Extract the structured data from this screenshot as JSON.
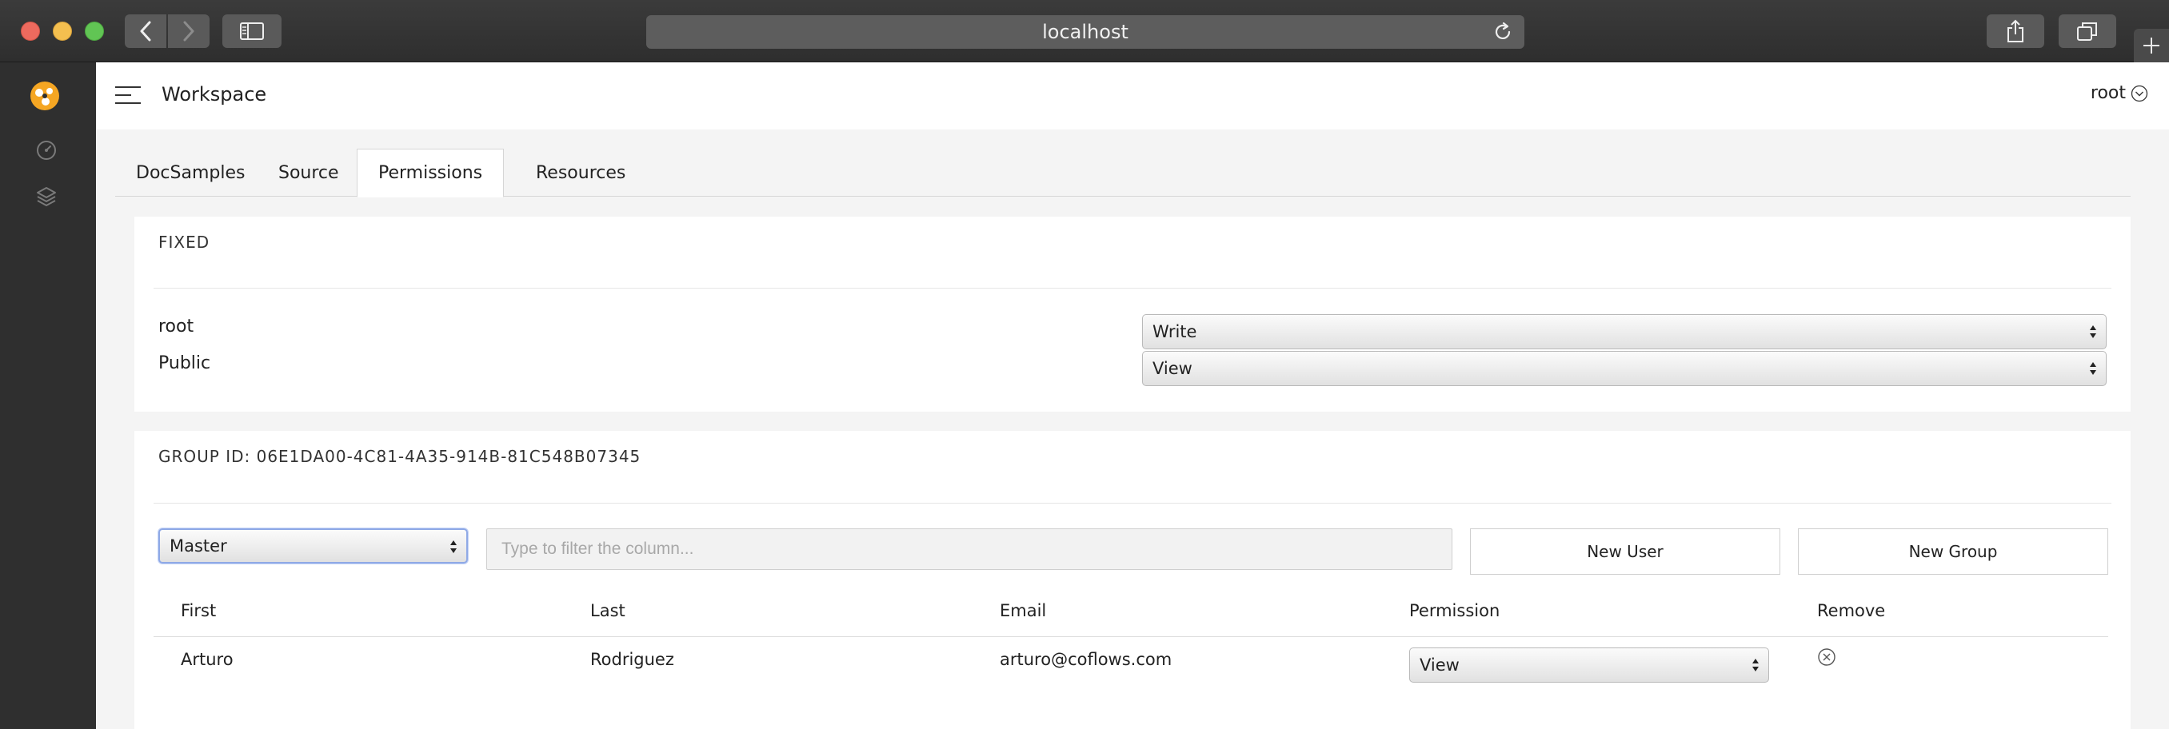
{
  "browser": {
    "url": "localhost"
  },
  "icons": {
    "logo": "app-logo-icon",
    "dashboard": "gauge-icon",
    "resources": "layers-icon",
    "user_chevron": "chevron-down-circle-icon",
    "remove": "close-circle-icon"
  },
  "header": {
    "title": "Workspace",
    "user": "root"
  },
  "tabs": [
    {
      "label": "DocSamples"
    },
    {
      "label": "Source"
    },
    {
      "label": "Permissions",
      "active": true
    },
    {
      "label": "Resources"
    }
  ],
  "fixed": {
    "title": "FIXED",
    "rows": [
      {
        "name": "root",
        "permission": "Write"
      },
      {
        "name": "Public",
        "permission": "View"
      }
    ]
  },
  "group": {
    "title": "GROUP ID: 06E1DA00-4C81-4A35-914B-81C548B07345",
    "group_select": "Master",
    "filter_placeholder": "Type to filter the column...",
    "new_user_label": "New User",
    "new_group_label": "New Group",
    "columns": [
      "First",
      "Last",
      "Email",
      "Permission",
      "Remove"
    ],
    "rows": [
      {
        "first": "Arturo",
        "last": "Rodriguez",
        "email": "arturo@coflows.com",
        "permission": "View"
      }
    ]
  },
  "colors": {
    "sidebar_bg": "#2f2f2f",
    "logo_orange": "#f5a623",
    "focus_blue": "#8fa9e6"
  }
}
